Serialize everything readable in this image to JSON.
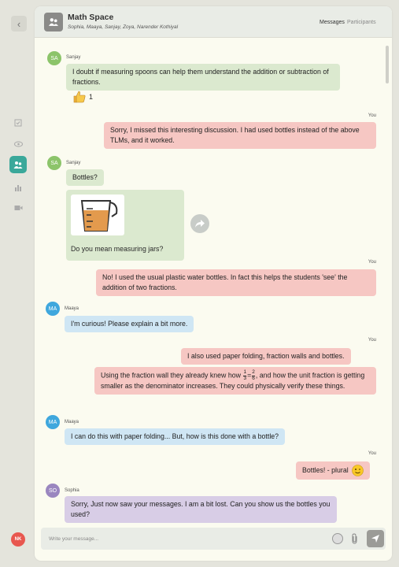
{
  "sidebar": {
    "back_icon": "chevron-left-icon",
    "nav": [
      "checkbox-icon",
      "eye-icon",
      "group-icon",
      "bar-chart-icon",
      "video-icon"
    ],
    "user_initials": "NK"
  },
  "header": {
    "title": "Math Space",
    "members": "Sophia, Maaya, Sanjay, Zoya, Narender Kothiyal",
    "tabs": {
      "messages": "Messages",
      "participants": "Participants"
    }
  },
  "you_label": "You",
  "messages": {
    "m1": {
      "sender": "Sanjay",
      "initials": "SA",
      "text": "I doubt if measuring spoons can help them understand the addition or subtraction of fractions.",
      "reaction_count": "1"
    },
    "m2": {
      "text": "Sorry, I missed this interesting discussion. I had used bottles instead of the above TLMs, and it worked."
    },
    "m3": {
      "sender": "Sanjay",
      "initials": "SA",
      "text": "Bottles?",
      "caption": "Do you mean measuring jars?"
    },
    "m4": {
      "text": "No! I used the usual plastic water bottles. In fact this helps the students 'see' the addition of two fractions."
    },
    "m5": {
      "sender": "Maaya",
      "initials": "MA",
      "text": "I'm curious! Please explain a bit more."
    },
    "m6": {
      "text": "I also used paper folding, fraction walls and bottles."
    },
    "m7": {
      "text_a": "Using the fraction wall they already knew how",
      "frac1_num": "1",
      "frac1_den": "3",
      "eq": "=",
      "frac2_num": "2",
      "frac2_den": "6",
      "text_b": ", and how the unit fraction is getting smaller as the denominator increases. They could physically verify these things."
    },
    "m8": {
      "sender": "Maaya",
      "initials": "MA",
      "text": "I can do this with paper folding... But, how is this done with a bottle?"
    },
    "m9": {
      "text": "Bottles! - plural"
    },
    "m10": {
      "sender": "Sophia",
      "initials": "SO",
      "text": "Sorry, Just now saw your messages. I am a bit lost. Can you show us the bottles you used?"
    }
  },
  "composer": {
    "placeholder": "Write your message..."
  },
  "colors": {
    "green_avatar": "#8cc46a",
    "blue_avatar": "#3fa7dd",
    "purple_avatar": "#9a86bf",
    "active_nav": "#3aa89a"
  }
}
